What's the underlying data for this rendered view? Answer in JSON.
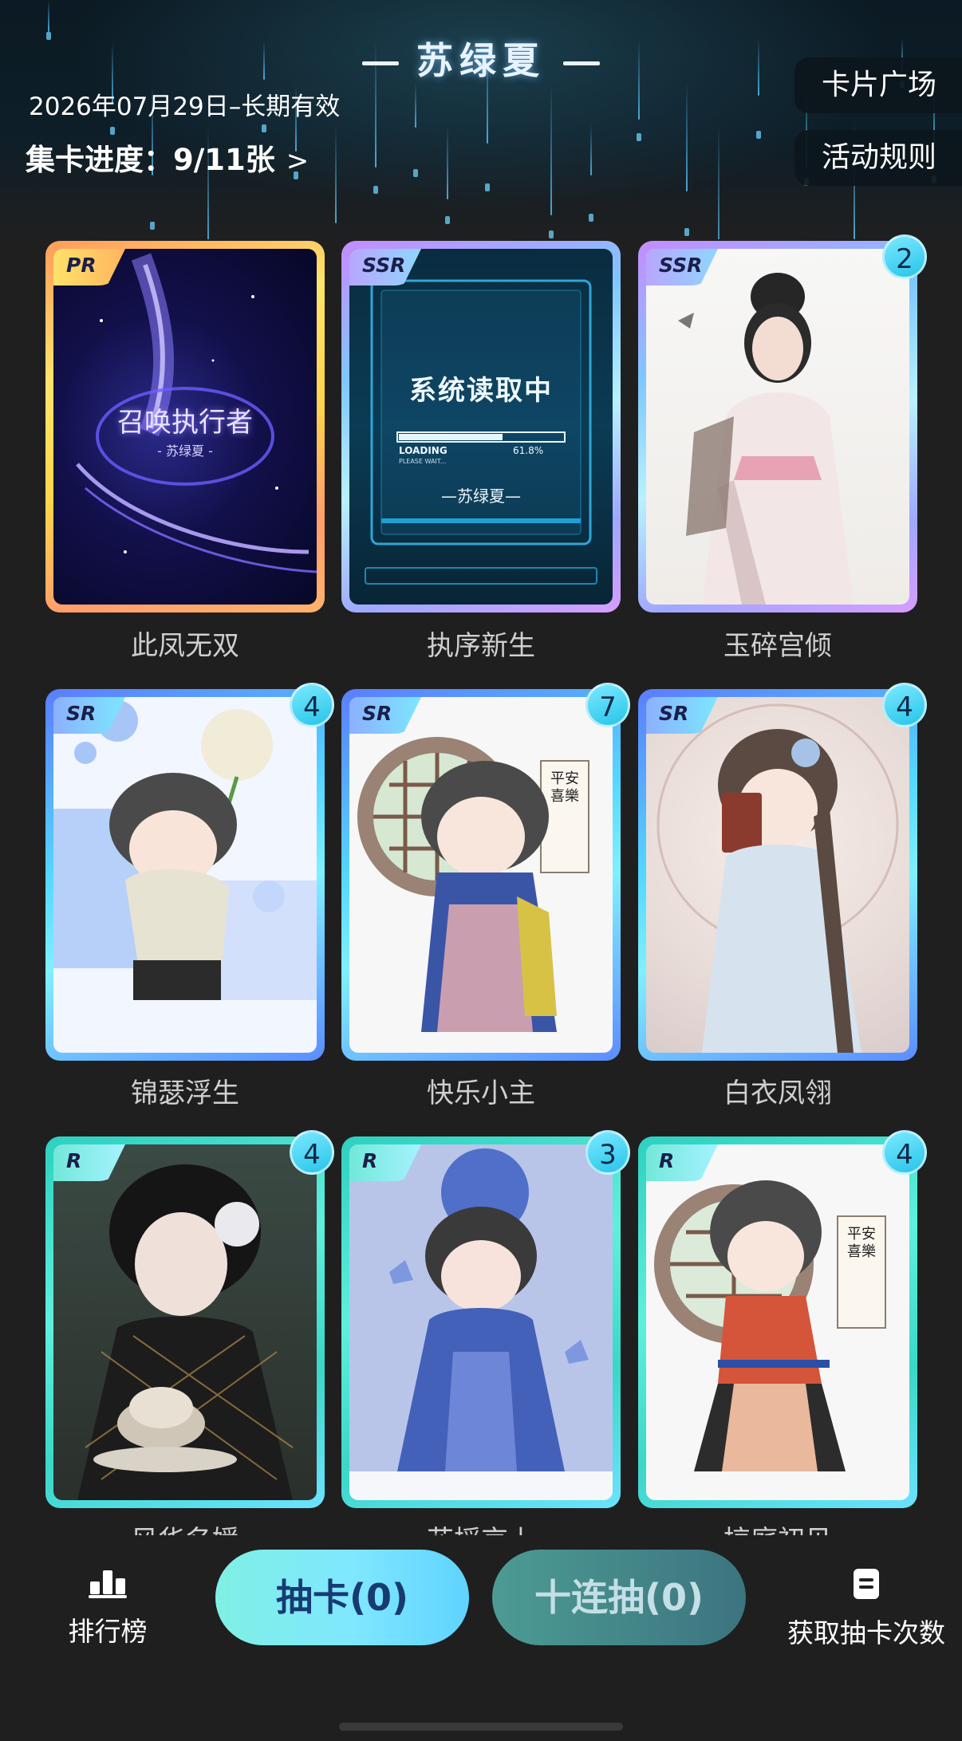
{
  "header": {
    "title": "苏绿夏",
    "validity": "2026年07月29日–长期有效",
    "progress_label": "集卡进度：9/11张",
    "progress_chevron": ">",
    "card_plaza": "卡片广场",
    "activity_rules": "活动规则"
  },
  "cards": [
    {
      "rarity": "PR",
      "name": "此凤无双",
      "count": "",
      "art_text": "召唤执行者",
      "art_sub": "- 苏绿夏 -"
    },
    {
      "rarity": "SSR",
      "name": "执序新生",
      "count": "",
      "art_text": "系统读取中",
      "art_loading": "LOADING",
      "art_percent": "61.8%",
      "art_wait": "PLEASE WAIT...",
      "art_sub": "—苏绿夏—"
    },
    {
      "rarity": "SSR",
      "name": "玉碎宫倾",
      "count": "2"
    },
    {
      "rarity": "SR",
      "name": "锦瑟浮生",
      "count": "4"
    },
    {
      "rarity": "SR",
      "name": "快乐小主",
      "count": "7",
      "art_scroll": "平安喜樂"
    },
    {
      "rarity": "SR",
      "name": "白衣凤翎",
      "count": "4"
    },
    {
      "rarity": "R",
      "name": "风华名媛",
      "count": "4"
    },
    {
      "rarity": "R",
      "name": "花摇京上",
      "count": "3"
    },
    {
      "rarity": "R",
      "name": "掠庭初见",
      "count": "4",
      "art_scroll": "平安喜樂"
    }
  ],
  "bottom": {
    "rank_label": "排行榜",
    "draw_label": "抽卡(0)",
    "ten_draw_label": "十连抽(0)",
    "get_times_label": "获取抽卡次数"
  },
  "colors": {
    "background": "#1f1f20",
    "draw_button": "#7fe7ff",
    "ten_draw_button": "#3c7480",
    "badge": "#27c4e9"
  }
}
